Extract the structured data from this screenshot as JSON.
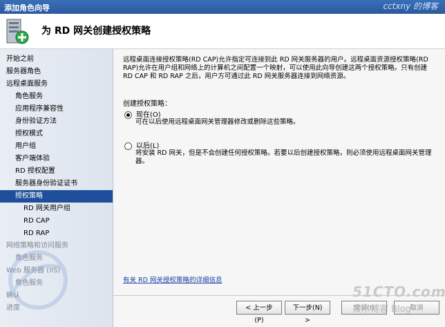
{
  "window": {
    "title": "添加角色向导",
    "watermark": "cctxny 的博客"
  },
  "header": {
    "title": "为 RD 网关创建授权策略"
  },
  "sidebar": {
    "items": [
      {
        "label": "开始之前",
        "level": 0,
        "state": "normal"
      },
      {
        "label": "服务器角色",
        "level": 0,
        "state": "normal"
      },
      {
        "label": "远程桌面服务",
        "level": 0,
        "state": "normal"
      },
      {
        "label": "角色服务",
        "level": 1,
        "state": "normal"
      },
      {
        "label": "应用程序兼容性",
        "level": 1,
        "state": "normal"
      },
      {
        "label": "身份验证方法",
        "level": 1,
        "state": "normal"
      },
      {
        "label": "授权模式",
        "level": 1,
        "state": "normal"
      },
      {
        "label": "用户组",
        "level": 1,
        "state": "normal"
      },
      {
        "label": "客户端体验",
        "level": 1,
        "state": "normal"
      },
      {
        "label": "RD 授权配置",
        "level": 1,
        "state": "normal"
      },
      {
        "label": "服务器身份验证证书",
        "level": 1,
        "state": "normal"
      },
      {
        "label": "授权策略",
        "level": 1,
        "state": "selected"
      },
      {
        "label": "RD 网关用户组",
        "level": 2,
        "state": "normal"
      },
      {
        "label": "RD CAP",
        "level": 2,
        "state": "normal"
      },
      {
        "label": "RD RAP",
        "level": 2,
        "state": "normal"
      },
      {
        "label": "网络策略和访问服务",
        "level": 0,
        "state": "disabled"
      },
      {
        "label": "角色服务",
        "level": 1,
        "state": "disabled"
      },
      {
        "label": "Web 服务器 (IIS)",
        "level": 0,
        "state": "disabled"
      },
      {
        "label": "角色服务",
        "level": 1,
        "state": "disabled"
      },
      {
        "label": "确认",
        "level": 0,
        "state": "disabled"
      },
      {
        "label": "进度",
        "level": 0,
        "state": "disabled"
      }
    ]
  },
  "content": {
    "intro": "远程桌面连接授权策略(RD CAP)允许指定可连接到此 RD 网关服务器的用户。远程桌面资源授权策略(RD RAP)允许在用户组和网络上的计算机之间配置一个映射，可以使用此向导创建这两个授权策略。只有创建 RD CAP 和 RD RAP 之后，用户方可通过此 RD 网关服务器连接到网络资源。",
    "section_label": "创建授权策略：",
    "option_now": {
      "label": "现在(O)",
      "selected": true,
      "desc": "可在以后使用远程桌面网关管理器修改或删除这些策略。"
    },
    "option_later": {
      "label": "以后(L)",
      "selected": false,
      "desc": "将安装 RD 网关，但是不会创建任何授权策略。若要以后创建授权策略，则必须使用远程桌面网关管理器。"
    },
    "help_link": "有关 RD 网关授权策略的详细信息"
  },
  "buttons": {
    "back": "< 上一步(P)",
    "next": "下一步(N) >",
    "install": "安装(I)",
    "cancel": "取消"
  },
  "watermarks": {
    "site": "51CTO.com",
    "blog": "技术博客  Blog"
  }
}
